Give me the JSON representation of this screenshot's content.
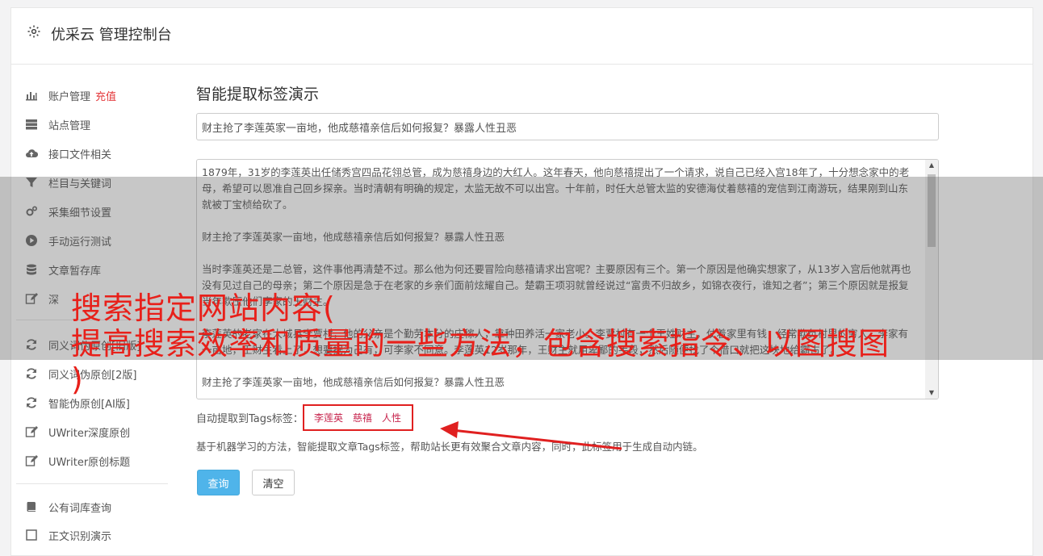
{
  "header": {
    "title": "优采云 管理控制台",
    "icon": "gear-icon"
  },
  "sidebar": {
    "items": [
      {
        "label": "账户管理",
        "extra": "充值",
        "icon": "bar-chart-icon"
      },
      {
        "label": "站点管理",
        "icon": "server-icon"
      },
      {
        "label": "接口文件相关",
        "icon": "cloud-upload-icon"
      },
      {
        "label": "栏目与关键词",
        "icon": "filter-icon"
      },
      {
        "label": "采集细节设置",
        "icon": "cogs-icon"
      },
      {
        "label": "手动运行测试",
        "icon": "play-circle-icon"
      },
      {
        "label": "文章暂存库",
        "icon": "database-icon"
      },
      {
        "label": "深",
        "icon": "edit-icon"
      },
      {
        "label": "同义词伪原创[旧版]",
        "icon": "refresh-icon"
      },
      {
        "label": "同义词伪原创[2版]",
        "icon": "refresh-icon"
      },
      {
        "label": "智能伪原创[AI版]",
        "icon": "refresh-icon"
      },
      {
        "label": "UWriter深度原创",
        "icon": "edit-icon"
      },
      {
        "label": "UWriter原创标题",
        "icon": "edit-icon"
      },
      {
        "label": "公有词库查询",
        "icon": "book-icon"
      },
      {
        "label": "正文识别演示",
        "icon": "square-icon"
      }
    ]
  },
  "main": {
    "title": "智能提取标签演示",
    "title_input_value": "财主抢了李莲英家一亩地，他成慈禧亲信后如何报复？暴露人性丑恶",
    "content_paragraphs": [
      "1879年，31岁的李莲英出任储秀宫四品花翎总管，成为慈禧身边的大红人。这年春天，他向慈禧提出了一个请求，说自己已经入宫18年了，十分想念家中的老母，希望可以恩准自己回乡探亲。当时清朝有明确的规定，太监无故不可以出宫。十年前，时任大总管太监的安德海仗着慈禧的宠信到江南游玩，结果刚到山东就被丁宝桢给砍了。",
      "财主抢了李莲英家一亩地，他成慈禧亲信后如何报复？暴露人性丑恶",
      "当时李莲英还是二总管，这件事他再清楚不过。那么他为何还要冒险向慈禧请求出宫呢？主要原因有三个。第一个原因是他确实想家了，从13岁入宫后他就再也没有见过自己的母亲；第二个原因是急于在老家的乡亲们面前炫耀自己。楚霸王项羽就曾经说过“富贵不归故乡，如锦衣夜行，谁知之者”；第三个原因就是报复当年欺压他们李家的王财主。",
      "李莲英的老家在大城县李贾村，他的父亲是个勤劳本分的庄稼人，靠种田养活一家老小。李贾村有一个王姓财主，仗着家里有钱，经常欺负村里的穷人。李家有一亩地，王财主看上了，想要据为己有，可李家不同意。李莲英12岁那年，王财主就用卑鄙的手段，然后随便找了个借口就把这块地给霸占了。",
      "财主抢了李莲英家一亩地，他成慈禧亲信后如何报复？暴露人性丑恶"
    ],
    "tags_label": "自动提取到Tags标签：",
    "tags": [
      "李莲英",
      "慈禧",
      "人性"
    ],
    "help_text": "基于机器学习的方法，智能提取文章Tags标签，帮助站长更有效聚合文章内容，同时，此标签用于生成自动内链。",
    "query_label": "查询",
    "clear_label": "清空"
  },
  "overlay": {
    "line1": "搜索指定网站内容(",
    "line2": "提高搜索效率和质量的一些方法，包含搜索指令、以图搜图",
    "line3": ")"
  }
}
